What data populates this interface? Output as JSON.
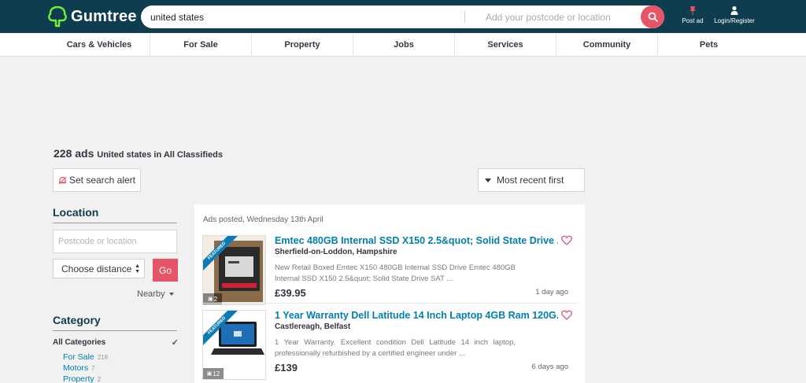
{
  "header": {
    "logo_text": "Gumtree",
    "search_query": "united states",
    "location_placeholder": "Add your postcode or location",
    "post_ad_label": "Post ad",
    "login_label": "Login/Register"
  },
  "categories": [
    "Cars & Vehicles",
    "For Sale",
    "Property",
    "Jobs",
    "Services",
    "Community",
    "Pets"
  ],
  "results": {
    "count": "228 ads",
    "summary": "United states in All Classifieds",
    "alert_label": "Set search alert",
    "sort_label": "Most recent first"
  },
  "sidebar": {
    "location_heading": "Location",
    "location_placeholder": "Postcode or location",
    "distance_label": "Choose distance",
    "go_label": "Go",
    "nearby_label": "Nearby",
    "category_heading": "Category",
    "all_categories_label": "All Categories",
    "subcategories": [
      {
        "label": "For Sale",
        "count": "218"
      },
      {
        "label": "Motors",
        "count": "7"
      },
      {
        "label": "Property",
        "count": "2"
      }
    ]
  },
  "listings": {
    "date_header": "Ads posted, Wednesday 13th April",
    "items": [
      {
        "title": "Emtec 480GB Internal SSD X150 2.5&quot; Solid State Drive ...",
        "location": "Sherfield-on-Loddon, Hampshire",
        "description": "New Retail Boxed Emtec X150 480GB Internal SSD Drive Emtec 480GB Internal SSD X150 2.5&quot; Solid State Drive SAT ...",
        "price": "£39.95",
        "age": "1 day ago",
        "photo_count": "2",
        "badge": "FEATURED"
      },
      {
        "title": "1 Year Warranty Dell Latitude 14 Inch Laptop 4GB Ram 120G...",
        "location": "Castlereagh, Belfast",
        "description": "1 Year Warranty. Excellent condition Dell Latitude 14 inch laptop, professionally refurbished by a certified engineer under ...",
        "price": "£139",
        "age": "6 days ago",
        "photo_count": "12",
        "badge": "FEATURED"
      }
    ]
  },
  "colors": {
    "header_bg": "#0e3d4f",
    "accent": "#e55467",
    "link": "#007fb0"
  }
}
